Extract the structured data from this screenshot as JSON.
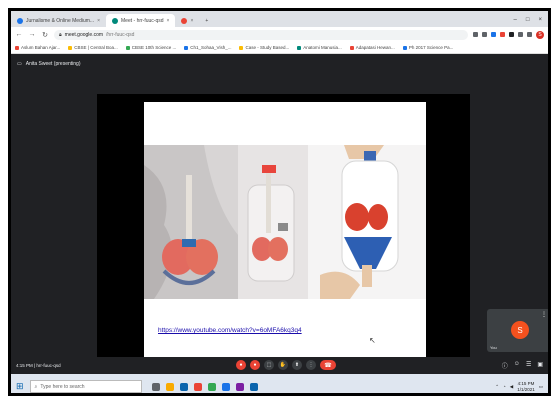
{
  "browser": {
    "tabs": [
      {
        "label": "Jurnalisme & Online Medium...",
        "icon_color": "#1a73e8",
        "active": false
      },
      {
        "label": "Meet - hrr-fuuc-qsd",
        "icon_color": "#00897b",
        "active": true
      },
      {
        "label": "",
        "icon_color": "#ea4335",
        "active": false
      }
    ],
    "new_tab": "+",
    "window_controls": [
      "–",
      "□",
      "×"
    ],
    "url_host": "meet.google.com",
    "url_path": "/hrr-fuuc-qsd",
    "profile_initial": "S",
    "bookmarks": [
      {
        "label": "Aslum Bahan Ajar...",
        "color": "#ea4335"
      },
      {
        "label": "CBSE | Central Boa...",
        "color": "#fbbc04"
      },
      {
        "label": "CBSE 10th Science ...",
        "color": "#34a853"
      },
      {
        "label": "Ch1_Sohaa_Vish_...",
        "color": "#1a73e8"
      },
      {
        "label": "Case - Study Based...",
        "color": "#fbbc04"
      },
      {
        "label": "Anatomi Manusia...",
        "color": "#00897b"
      },
      {
        "label": "Adapatasi Hewan...",
        "color": "#ea4335"
      },
      {
        "label": "Ph 2017 Science Pa...",
        "color": "#1a73e8"
      }
    ]
  },
  "meet": {
    "presenter_label": "Anita Sweet (presenting)",
    "slide_link": "https://www.youtube.com/watch?v=6oMFA6kq3q4",
    "self_initial": "S",
    "self_name": "You",
    "time_label": "4:15 PM  |  hrr-fuuc-qsd",
    "controls": [
      "●",
      "●",
      "⬚",
      "✋",
      "⬆",
      "⋮"
    ],
    "leave_icon": "☎",
    "side_icons": [
      "ⓘ",
      "☺",
      "☰",
      "▣"
    ]
  },
  "taskbar": {
    "search_placeholder": "Type here to search",
    "app_colors": [
      "#f9ab00",
      "#0a64ad",
      "#ea4335",
      "#34a853",
      "#fbbc04",
      "#1a73e8",
      "#7b1fa2",
      "#0a64ad"
    ],
    "clock_time": "4:15 PM",
    "clock_date": "1/1/2021"
  }
}
